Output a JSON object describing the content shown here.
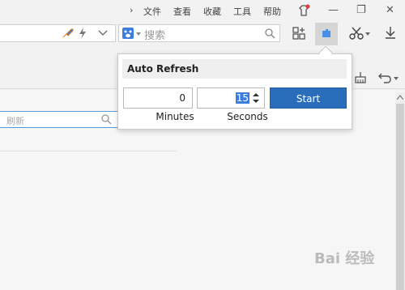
{
  "menu": {
    "chevron": "›",
    "items": [
      "文件",
      "查看",
      "收藏",
      "工具",
      "帮助"
    ]
  },
  "window_controls": {
    "minimize": "—",
    "restore": "❐",
    "close": "✕"
  },
  "search": {
    "engine_icon": "paw-icon",
    "placeholder": "搜索"
  },
  "filter": {
    "placeholder": "刷新"
  },
  "popup": {
    "title": "Auto Refresh",
    "minutes_value": "0",
    "seconds_value": "15",
    "minutes_label": "Minutes",
    "seconds_label": "Seconds",
    "start_label": "Start"
  },
  "watermark": "Bai 经验",
  "colors": {
    "accent": "#2a6ebb",
    "focus": "#5b9bd5"
  }
}
